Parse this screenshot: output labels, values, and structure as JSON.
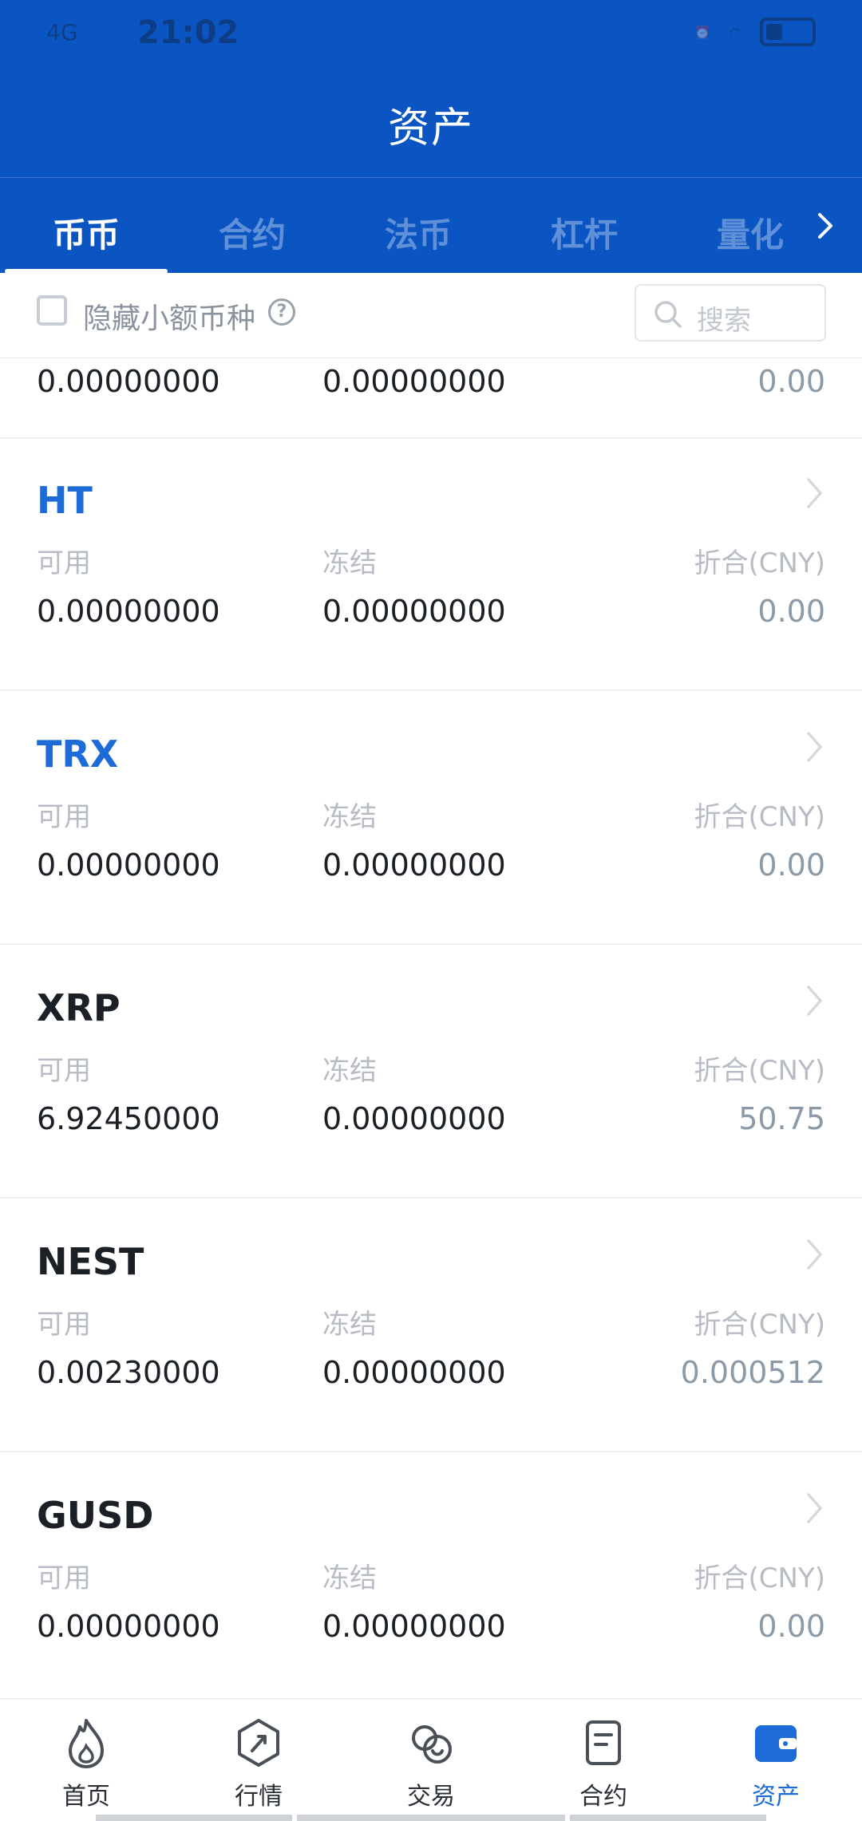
{
  "status_bar": {
    "time": "21:02",
    "signal": "4G"
  },
  "header": {
    "title": "资产"
  },
  "tabs": [
    {
      "label": "币币",
      "active": true
    },
    {
      "label": "合约",
      "active": false
    },
    {
      "label": "法币",
      "active": false
    },
    {
      "label": "杠杆",
      "active": false
    },
    {
      "label": "量化",
      "active": false
    }
  ],
  "filter": {
    "hide_small_label": "隐藏小额币种",
    "search_placeholder": "搜索"
  },
  "labels": {
    "available": "可用",
    "frozen": "冻结",
    "cny": "折合(CNY)"
  },
  "partial_row": {
    "available": "0.00000000",
    "frozen": "0.00000000",
    "cny": "0.00"
  },
  "assets": [
    {
      "coin": "HT",
      "available": "0.00000000",
      "frozen": "0.00000000",
      "cny": "0.00",
      "highlight": true
    },
    {
      "coin": "TRX",
      "available": "0.00000000",
      "frozen": "0.00000000",
      "cny": "0.00",
      "highlight": true
    },
    {
      "coin": "XRP",
      "available": "6.92450000",
      "frozen": "0.00000000",
      "cny": "50.75",
      "highlight": false
    },
    {
      "coin": "NEST",
      "available": "0.00230000",
      "frozen": "0.00000000",
      "cny": "0.000512",
      "highlight": false
    },
    {
      "coin": "GUSD",
      "available": "0.00000000",
      "frozen": "0.00000000",
      "cny": "0.00",
      "highlight": false
    }
  ],
  "nav": [
    {
      "label": "首页",
      "icon": "home-flame-icon"
    },
    {
      "label": "行情",
      "icon": "market-icon"
    },
    {
      "label": "交易",
      "icon": "trade-icon"
    },
    {
      "label": "合约",
      "icon": "contract-icon"
    },
    {
      "label": "资产",
      "icon": "wallet-icon",
      "active": true
    }
  ],
  "colors": {
    "primary": "#0b55c3",
    "accent": "#1c6bd6",
    "muted": "#b7bcc4"
  }
}
